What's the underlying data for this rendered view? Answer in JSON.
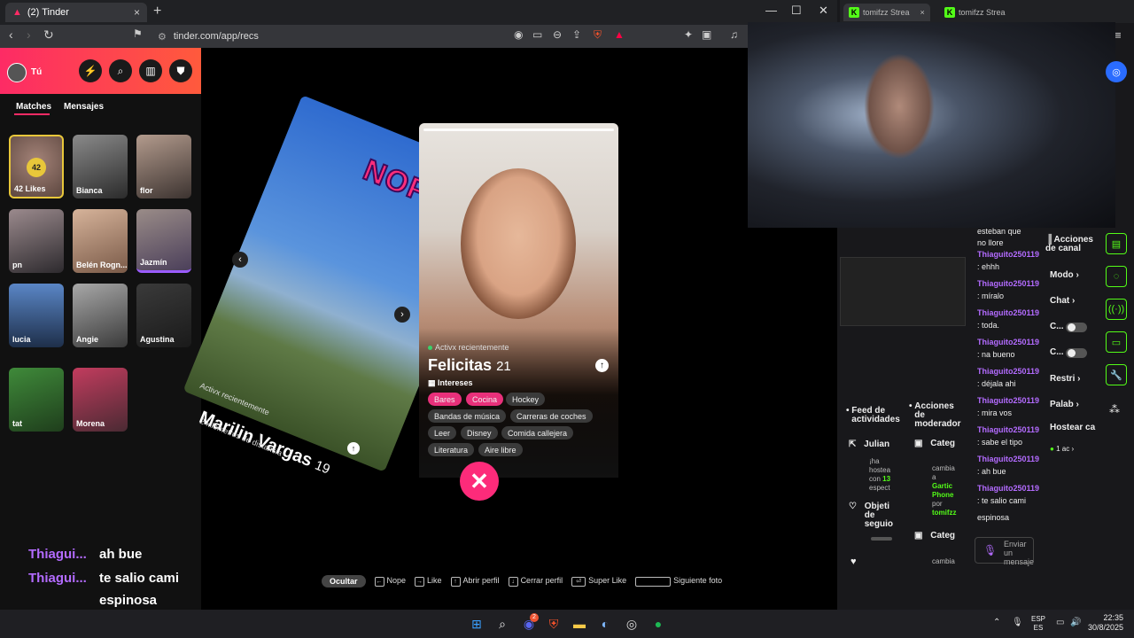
{
  "browser": {
    "tab_title": "(2) Tinder",
    "tab_close": "×",
    "new_tab": "+",
    "url": "tinder.com/app/recs",
    "win_min": "—",
    "win_max": "☐",
    "win_close": "✕"
  },
  "sidebar": {
    "user_label": "Tú",
    "tabs": [
      "Matches",
      "Mensajes"
    ],
    "likes_count": "42",
    "likes_label": "42 Likes",
    "matches": [
      "Bianca",
      "flor",
      "pn",
      "Belén Rogn...",
      "Jazmín",
      "lucia",
      "Angie",
      "Agustina",
      "tat",
      "Morena"
    ]
  },
  "chat_overlay": [
    {
      "user": "Thiagui...",
      "msg": "ah bue"
    },
    {
      "user": "Thiagui...",
      "msg": "te salio cami"
    },
    {
      "user": "",
      "msg": "espinosa"
    }
  ],
  "left_profile": {
    "stamp": "NOPE",
    "active": "Activx recientemente",
    "name": "Marilin Vargas",
    "age": "19",
    "distance": "2 kilómetros de distancia"
  },
  "profile": {
    "active": "Activx recientemente",
    "name": "Felicitas",
    "age": "21",
    "interests_label": "Intereses",
    "interests": [
      {
        "label": "Bares",
        "highlight": true
      },
      {
        "label": "Cocina",
        "highlight": true
      },
      {
        "label": "Hockey",
        "highlight": false
      },
      {
        "label": "Bandas de música",
        "highlight": false
      },
      {
        "label": "Carreras de coches",
        "highlight": false
      },
      {
        "label": "Leer",
        "highlight": false
      },
      {
        "label": "Disney",
        "highlight": false
      },
      {
        "label": "Comida callejera",
        "highlight": false
      },
      {
        "label": "Literatura",
        "highlight": false
      },
      {
        "label": "Aire libre",
        "highlight": false
      }
    ],
    "nope_glyph": "✕"
  },
  "hints": {
    "hide": "Ocultar",
    "nope": "Nope",
    "like": "Like",
    "open": "Abrir perfil",
    "close": "Cerrar perfil",
    "super": "Super Like",
    "next": "Siguiente foto"
  },
  "stream": {
    "tabs": [
      "tomifzz Strea",
      "tomifzz Strea"
    ],
    "chat": [
      {
        "user": "",
        "msg": "esteban que"
      },
      {
        "user": "",
        "msg": "no llore"
      },
      {
        "user": "Thiaguito250119",
        "msg": ": ehhh"
      },
      {
        "user": "Thiaguito250119",
        "msg": ": míralo"
      },
      {
        "user": "Thiaguito250119",
        "msg": ": toda."
      },
      {
        "user": "Thiaguito250119",
        "msg": ": na bueno"
      },
      {
        "user": "Thiaguito250119",
        "msg": ": déjala ahi"
      },
      {
        "user": "Thiaguito250119",
        "msg": ": mira vos"
      },
      {
        "user": "Thiaguito250119",
        "msg": ": sabe el tipo"
      },
      {
        "user": "Thiaguito250119",
        "msg": ": ah bue"
      },
      {
        "user": "Thiaguito250119",
        "msg": ": te salio cami"
      },
      {
        "user": "",
        "msg": "espinosa"
      }
    ],
    "chat_placeholder": "Enviar un mensaje",
    "channel_actions": "Acciones de canal",
    "channel_items": [
      "Modo",
      "Chat",
      "C...",
      "C...",
      "Restri",
      "Palab",
      "Hostear ca",
      "1 ac"
    ],
    "feed_title": "Feed de actividades",
    "mod_title": "Acciones de moderador",
    "feed_user": "Julian",
    "feed_text": [
      "¡ha",
      "hostea",
      "con",
      "13",
      "espect"
    ],
    "feed_objective": "Objeti de seguio",
    "mod_categ": "Categ",
    "mod_text": [
      "cambia",
      "a",
      "Gartic",
      "Phone",
      "por",
      "tomifzz"
    ],
    "mod_categ2": "Categ",
    "mod_text2": "cambia"
  },
  "taskbar": {
    "lang_top": "ESP",
    "lang_bottom": "ES",
    "time": "22:35",
    "date": "30/8/2025",
    "discord_badge": "2"
  },
  "colors": {
    "tinder_pink": "#fd2b65",
    "kick_green": "#53fc18",
    "chat_purple": "#b36bff"
  }
}
